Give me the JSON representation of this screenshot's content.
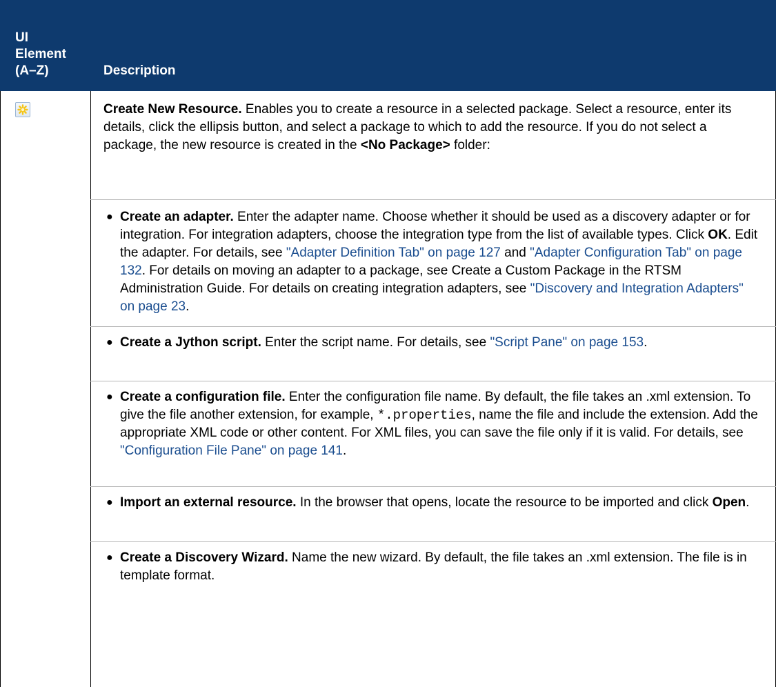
{
  "header": {
    "col1_line1": "UI",
    "col1_line2": "Element",
    "col1_line3": "(A–Z)",
    "col2": "Description"
  },
  "row": {
    "icon": "create-new-resource-icon",
    "title": "Create New Resource.",
    "intro_a": " Enables you to create a resource in a selected package. Select a resource, enter its details, click the ellipsis  button, and select a package to which to add the resource. If you do not select a package, the new resource is created in the ",
    "intro_bold": "<No Package>",
    "intro_b": " folder:",
    "bullets": [
      {
        "title": "Create an adapter.",
        "t1": " Enter the adapter name. Choose whether it should be used as a discovery adapter or for integration. For integration adapters, choose the integration type from the list of available types. Click ",
        "ok": "OK",
        "t2": ". Edit the adapter. For details, see ",
        "link1": "\"Adapter Definition Tab\" on page 127",
        "t3": " and ",
        "link2": "\"Adapter Configuration Tab\" on page 132",
        "t4": ". For details on moving an adapter to a package, see Create a Custom Package in the RTSM Administration Guide. For details on creating integration adapters, see ",
        "link3": "\"Discovery and Integration Adapters\" on page 23",
        "t5": "."
      },
      {
        "title": "Create a Jython script.",
        "t1": " Enter the script name. For details, see ",
        "link1": "\"Script Pane\" on page 153",
        "t2": "."
      },
      {
        "title": "Create a configuration file.",
        "t1": " Enter the configuration file name. By default, the file takes an .xml extension. To give the file another extension, for example, ",
        "code": "*.properties",
        "t2": ", name the file and include the extension. Add the appropriate XML code or other content. For XML files, you can save the file only if it is valid. For details, see ",
        "link1": "\"Configuration File Pane\" on page 141",
        "t3": "."
      },
      {
        "title": "Import an external resource.",
        "t1": " In the browser that opens, locate the resource to be imported and click ",
        "open": "Open",
        "t2": "."
      },
      {
        "title": "Create a Discovery Wizard.",
        "t1": " Name the new wizard. By default, the file takes an .xml extension. The file is in template format."
      }
    ]
  },
  "colors": {
    "header_bg": "#0e3a6e",
    "link": "#1a4d8f",
    "icon_star": "#f5c518"
  }
}
